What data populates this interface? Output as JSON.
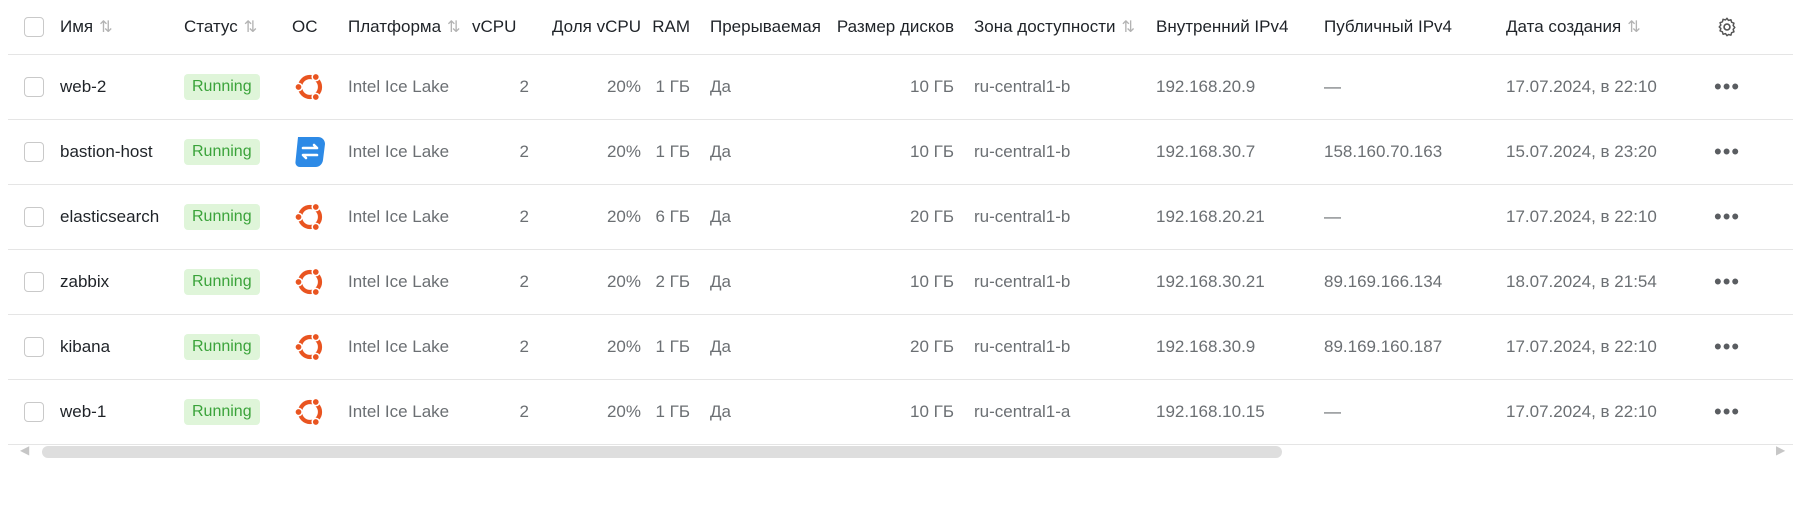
{
  "colors": {
    "running_bg": "#dff5d9",
    "running_text": "#3aa33a",
    "ubuntu": "#e95420",
    "almalinux_blue": "#2d8ae6"
  },
  "columns": {
    "name": "Имя",
    "status": "Статус",
    "os": "ОС",
    "platform": "Платформа",
    "vcpu": "vCPU",
    "vcpu_share": "Доля vCPU",
    "ram": "RAM",
    "preemptible": "Прерываемая",
    "disk_size": "Размер дисков",
    "zone": "Зона доступности",
    "internal_ip": "Внутренний IPv4",
    "public_ip": "Публичный IPv4",
    "created": "Дата создания"
  },
  "sort_icon": "⇅",
  "settings_icon": "gear-icon",
  "row_menu_glyph": "•••",
  "rows": [
    {
      "name": "web-2",
      "status": "Running",
      "os_icon": "ubuntu-icon",
      "platform": "Intel Ice Lake",
      "vcpu": "2",
      "vcpu_share": "20%",
      "ram": "1 ГБ",
      "preemptible": "Да",
      "disk_size": "10 ГБ",
      "zone": "ru-central1-b",
      "internal_ip": "192.168.20.9",
      "public_ip": "—",
      "created": "17.07.2024, в 22:10"
    },
    {
      "name": "bastion-host",
      "status": "Running",
      "os_icon": "almalinux-icon",
      "platform": "Intel Ice Lake",
      "vcpu": "2",
      "vcpu_share": "20%",
      "ram": "1 ГБ",
      "preemptible": "Да",
      "disk_size": "10 ГБ",
      "zone": "ru-central1-b",
      "internal_ip": "192.168.30.7",
      "public_ip": "158.160.70.163",
      "created": "15.07.2024, в 23:20"
    },
    {
      "name": "elasticsearch",
      "status": "Running",
      "os_icon": "ubuntu-icon",
      "platform": "Intel Ice Lake",
      "vcpu": "2",
      "vcpu_share": "20%",
      "ram": "6 ГБ",
      "preemptible": "Да",
      "disk_size": "20 ГБ",
      "zone": "ru-central1-b",
      "internal_ip": "192.168.20.21",
      "public_ip": "—",
      "created": "17.07.2024, в 22:10"
    },
    {
      "name": "zabbix",
      "status": "Running",
      "os_icon": "ubuntu-icon",
      "platform": "Intel Ice Lake",
      "vcpu": "2",
      "vcpu_share": "20%",
      "ram": "2 ГБ",
      "preemptible": "Да",
      "disk_size": "10 ГБ",
      "zone": "ru-central1-b",
      "internal_ip": "192.168.30.21",
      "public_ip": "89.169.166.134",
      "created": "18.07.2024, в 21:54"
    },
    {
      "name": "kibana",
      "status": "Running",
      "os_icon": "ubuntu-icon",
      "platform": "Intel Ice Lake",
      "vcpu": "2",
      "vcpu_share": "20%",
      "ram": "1 ГБ",
      "preemptible": "Да",
      "disk_size": "20 ГБ",
      "zone": "ru-central1-b",
      "internal_ip": "192.168.30.9",
      "public_ip": "89.169.160.187",
      "created": "17.07.2024, в 22:10"
    },
    {
      "name": "web-1",
      "status": "Running",
      "os_icon": "ubuntu-icon",
      "platform": "Intel Ice Lake",
      "vcpu": "2",
      "vcpu_share": "20%",
      "ram": "1 ГБ",
      "preemptible": "Да",
      "disk_size": "10 ГБ",
      "zone": "ru-central1-a",
      "internal_ip": "192.168.10.15",
      "public_ip": "—",
      "created": "17.07.2024, в 22:10"
    }
  ]
}
